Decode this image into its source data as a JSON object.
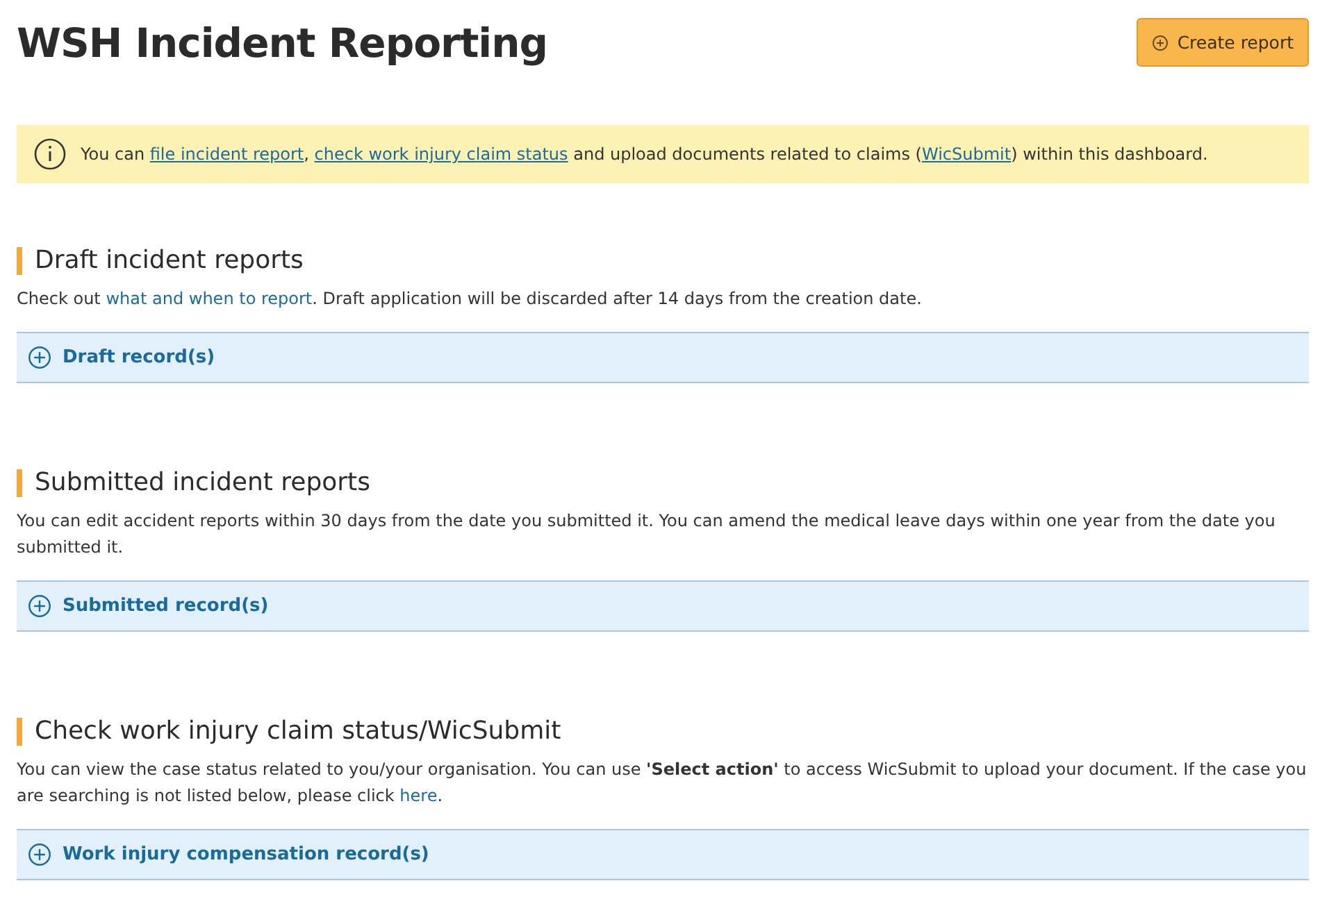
{
  "page": {
    "title": "WSH Incident Reporting"
  },
  "create_button": {
    "label": "Create report"
  },
  "notice": {
    "segments": [
      {
        "kind": "text",
        "text": "You can "
      },
      {
        "kind": "link",
        "text": "file incident report"
      },
      {
        "kind": "text",
        "text": ", "
      },
      {
        "kind": "link",
        "text": "check work injury claim status"
      },
      {
        "kind": "text",
        "text": " and upload documents related to claims ("
      },
      {
        "kind": "link",
        "text": "WicSubmit"
      },
      {
        "kind": "text",
        "text": ") within this dashboard."
      }
    ]
  },
  "sections": [
    {
      "heading": "Draft incident reports",
      "segments": [
        {
          "kind": "text",
          "text": "Check out "
        },
        {
          "kind": "link",
          "text": "what and when to report"
        },
        {
          "kind": "text",
          "text": ". Draft application will be discarded after 14 days from the creation date."
        }
      ],
      "panel": {
        "label": "Draft record(s)",
        "expanded": false
      }
    },
    {
      "heading": "Submitted incident reports",
      "segments": [
        {
          "kind": "text",
          "text": "You can edit accident reports within 30 days from the date you submitted it. You can amend the medical leave days within one year from the date you submitted it."
        }
      ],
      "panel": {
        "label": "Submitted record(s)",
        "expanded": false
      }
    },
    {
      "heading": "Check work injury claim status/WicSubmit",
      "segments": [
        {
          "kind": "text",
          "text": "You can view the case status related to you/your organisation. You can use **'Select action'** to access WicSubmit to upload your document. If the case you are searching is not listed below, please click "
        },
        {
          "kind": "link",
          "text": "here"
        },
        {
          "kind": "text",
          "text": "."
        }
      ],
      "panel": {
        "label": "Work injury compensation record(s)",
        "expanded": false
      }
    }
  ]
}
